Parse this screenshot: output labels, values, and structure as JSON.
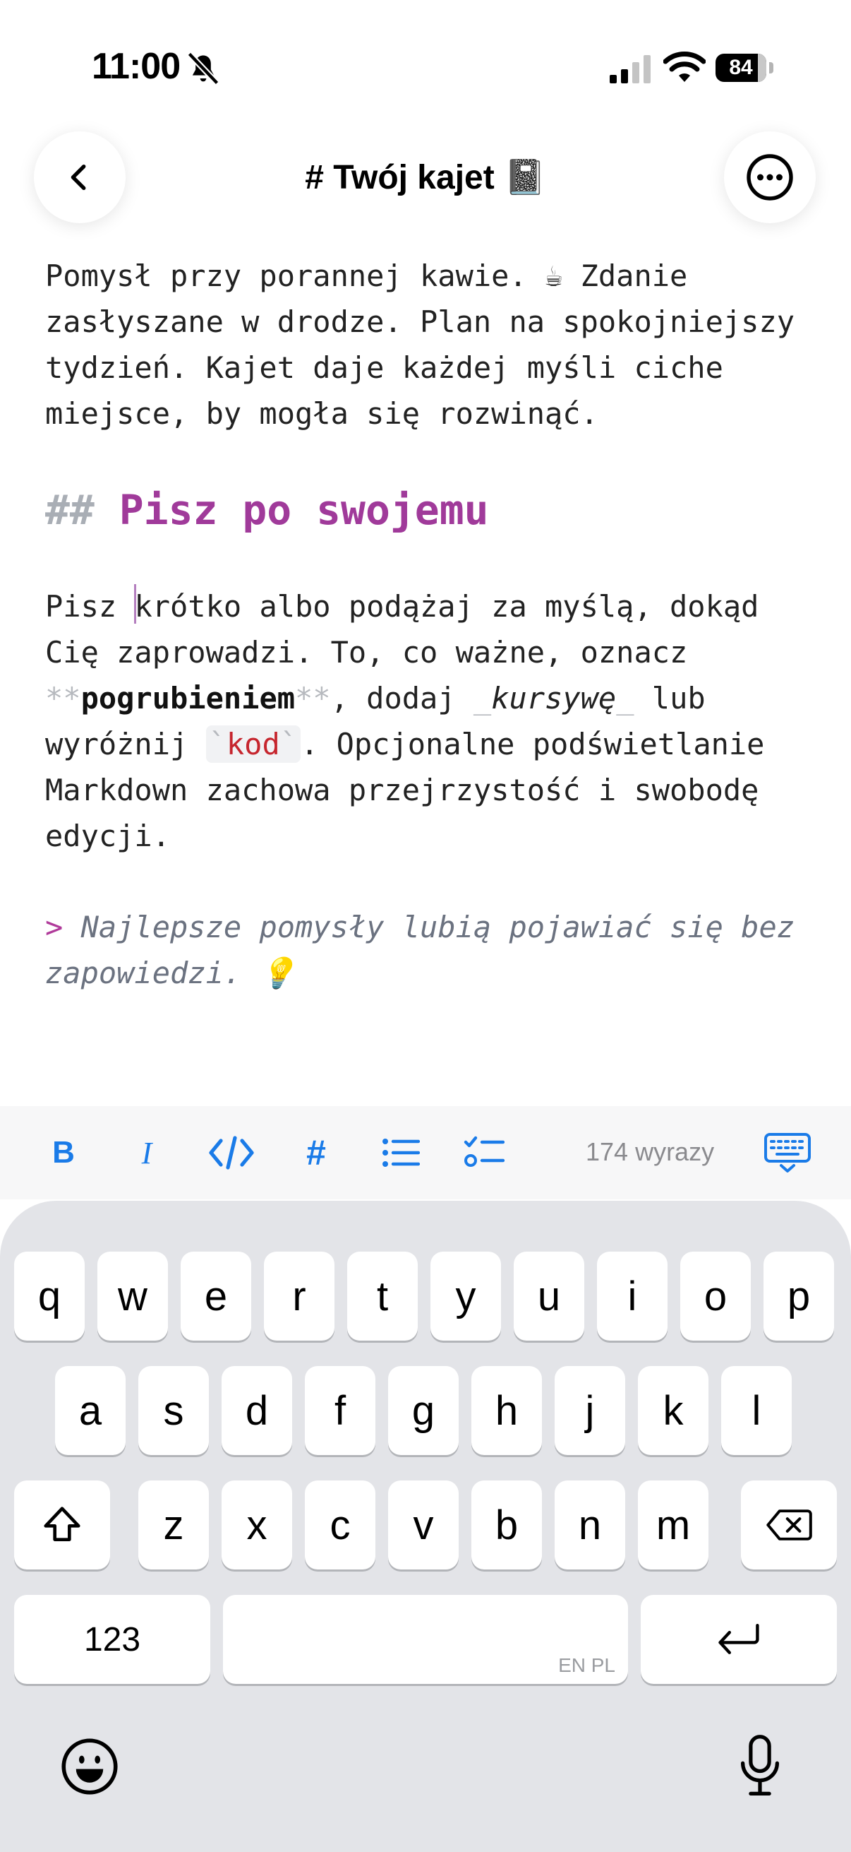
{
  "status_bar": {
    "time": "11:00",
    "battery_percent": "84",
    "battery_level": 0.84
  },
  "header": {
    "title": "# Twój kajet 📓"
  },
  "editor": {
    "intro": "Pomysł przy porannej kawie. ☕ Zdanie zasłyszane w drodze. Plan na spokojniejszy tydzień. Kajet daje każdej myśli ciche miejsce, by mogła się rozwinąć.",
    "heading_marker": "##",
    "heading_text": "Pisz po swojemu",
    "p2_pre_cursor": "Pisz ",
    "p2_a": "krótko albo podążaj za myślą, dokąd Cię zaprowadzi. To, co ważne, oznacz ",
    "bold_marker": "**",
    "bold_text": "pogrubieniem",
    "p2_b": ", dodaj ",
    "italic_marker": "_",
    "italic_text": "kursywę",
    "p2_c": " lub wyróżnij ",
    "code_tick": "`",
    "code_text": "kod",
    "p2_d": ". Opcjonalne podświetlanie Markdown zachowa przejrzystość i swobodę edycji.",
    "quote_marker": ">",
    "quote_text": "Najlepsze pomysły lubią pojawiać się bez zapowiedzi. 💡"
  },
  "toolbar": {
    "bold_label": "B",
    "italic_label": "I",
    "heading_label": "#",
    "word_count": "174 wyrazy"
  },
  "keyboard": {
    "row1": [
      "q",
      "w",
      "e",
      "r",
      "t",
      "y",
      "u",
      "i",
      "o",
      "p"
    ],
    "row2": [
      "a",
      "s",
      "d",
      "f",
      "g",
      "h",
      "j",
      "k",
      "l"
    ],
    "row3": [
      "z",
      "x",
      "c",
      "v",
      "b",
      "n",
      "m"
    ],
    "numbers_label": "123",
    "space_languages": "EN PL"
  },
  "colors": {
    "accent_blue": "#1a7be8",
    "heading_purple": "#a03a9a",
    "code_red": "#c6262e"
  }
}
